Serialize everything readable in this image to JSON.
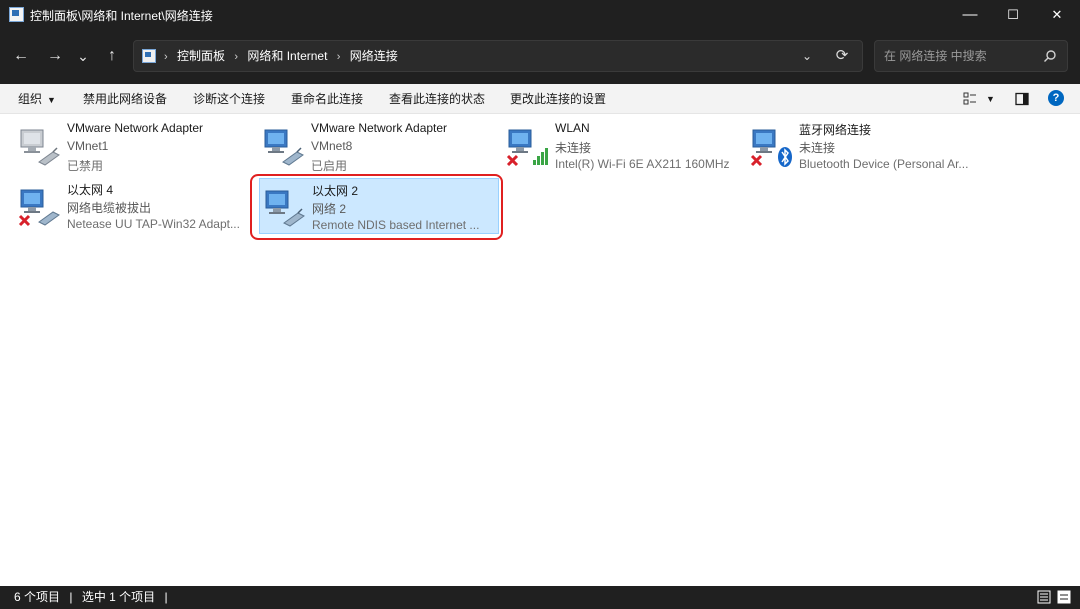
{
  "window": {
    "title": "控制面板\\网络和 Internet\\网络连接",
    "minimize": "—",
    "maximize": "☐",
    "close": "✕"
  },
  "nav": {
    "back": "←",
    "forward": "→",
    "recent": "⌄",
    "up": "↑",
    "breadcrumbs": [
      "控制面板",
      "网络和 Internet",
      "网络连接"
    ],
    "separator": "›",
    "dropdown": "⌄",
    "refresh": "⟳",
    "search_placeholder": "在 网络连接 中搜索"
  },
  "toolbar": {
    "organize": "组织",
    "disable": "禁用此网络设备",
    "diagnose": "诊断这个连接",
    "rename": "重命名此连接",
    "view_status": "查看此连接的状态",
    "change_settings": "更改此连接的设置",
    "help": "?"
  },
  "connections": [
    {
      "name": "VMware Network Adapter VMnet1",
      "line1": "VMware Network Adapter",
      "line2": "VMnet1",
      "line3": "已禁用",
      "icon": "network-adapter-disabled-icon"
    },
    {
      "name": "VMware Network Adapter VMnet8",
      "line1": "VMware Network Adapter",
      "line2": "VMnet8",
      "line3": "已启用",
      "icon": "network-adapter-icon"
    },
    {
      "name": "WLAN",
      "line1": "WLAN",
      "line2": "未连接",
      "line3": "Intel(R) Wi-Fi 6E AX211 160MHz",
      "icon": "wifi-adapter-icon"
    },
    {
      "name": "蓝牙网络连接",
      "line1": "蓝牙网络连接",
      "line2": "未连接",
      "line3": "Bluetooth Device (Personal Ar...",
      "icon": "bluetooth-adapter-icon"
    },
    {
      "name": "以太网 4",
      "line1": "以太网 4",
      "line2": "网络电缆被拔出",
      "line3": "Netease UU TAP-Win32 Adapt...",
      "icon": "network-adapter-unplugged-icon"
    },
    {
      "name": "以太网 2",
      "line1": "以太网 2",
      "line2": "网络 2",
      "line3": "Remote NDIS based Internet ...",
      "icon": "network-adapter-icon",
      "selected": true
    }
  ],
  "status": {
    "count": "6 个项目",
    "sep": "|",
    "selected": "选中 1 个项目",
    "sep2": "|"
  },
  "colors": {
    "titlebar_bg": "#202020",
    "selection_bg": "#cce8ff",
    "selection_border": "#99d1ff",
    "highlight_ring": "#e02020",
    "help_blue": "#0067c0"
  }
}
